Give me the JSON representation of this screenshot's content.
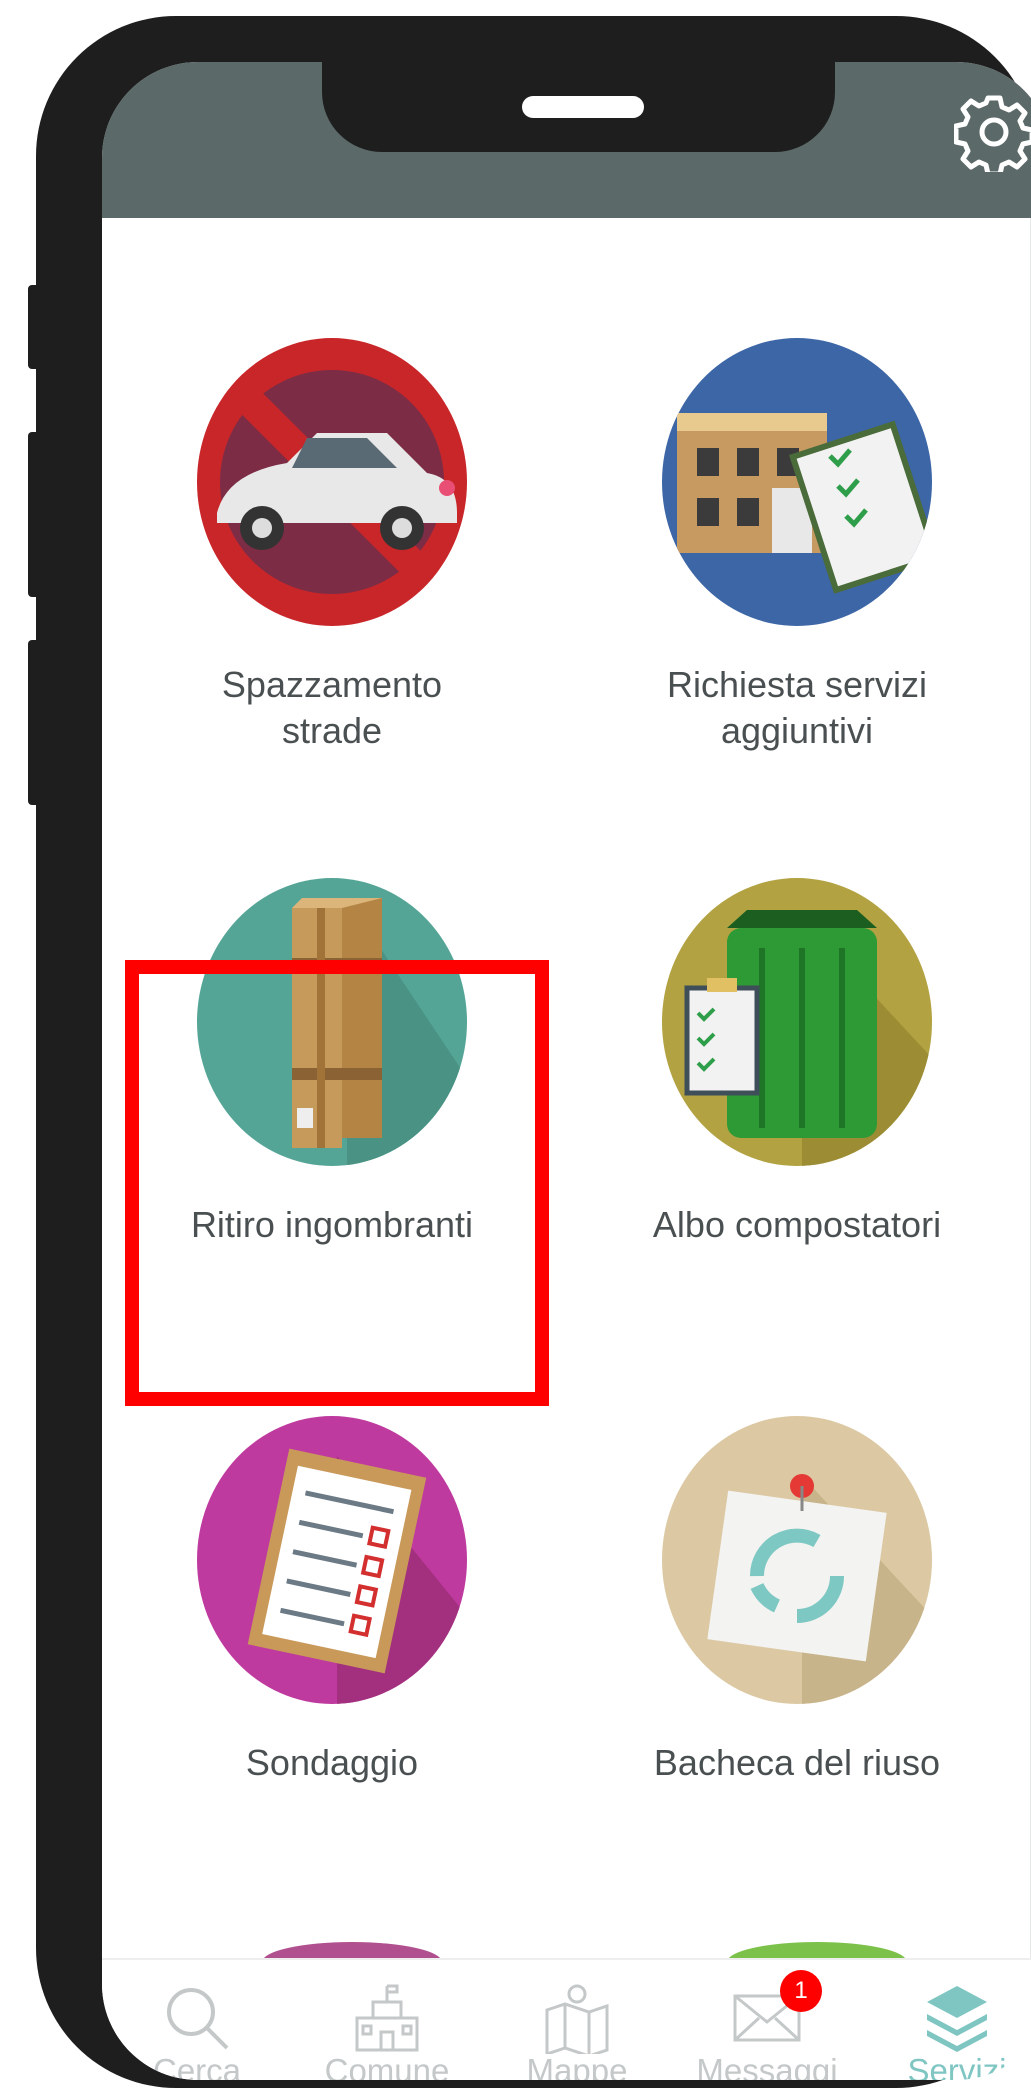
{
  "header": {
    "settings_icon": "gear-icon"
  },
  "services": [
    {
      "label": "Spazzamento\nstrade",
      "icon": "no-parking-car-icon",
      "color": "#c9262a"
    },
    {
      "label": "Richiesta servizi\naggiuntivi",
      "icon": "building-clipboard-icon",
      "color": "#3d66a6"
    },
    {
      "label": "Ritiro ingombranti",
      "icon": "cardboard-box-icon",
      "color": "#55a597"
    },
    {
      "label": "Albo compostatori",
      "icon": "compost-bin-icon",
      "color": "#b2a241"
    },
    {
      "label": "Sondaggio",
      "icon": "survey-clipboard-icon",
      "color": "#bf3a9e"
    },
    {
      "label": "Bacheca del riuso",
      "icon": "recycle-note-icon",
      "color": "#dcc9a4"
    }
  ],
  "tabbar": {
    "tabs": [
      {
        "label": "Cerca",
        "icon": "search-icon"
      },
      {
        "label": "Comune",
        "icon": "town-hall-icon"
      },
      {
        "label": "Mappe",
        "icon": "map-icon"
      },
      {
        "label": "Messaggi",
        "icon": "mail-icon",
        "badge": "1"
      },
      {
        "label": "Servizi",
        "icon": "layers-icon",
        "active": true
      }
    ]
  },
  "colors": {
    "header": "#5b6968",
    "active_tab": "#7fc6c3",
    "inactive_tab": "#c4c8c8",
    "highlight": "#ff0000"
  }
}
